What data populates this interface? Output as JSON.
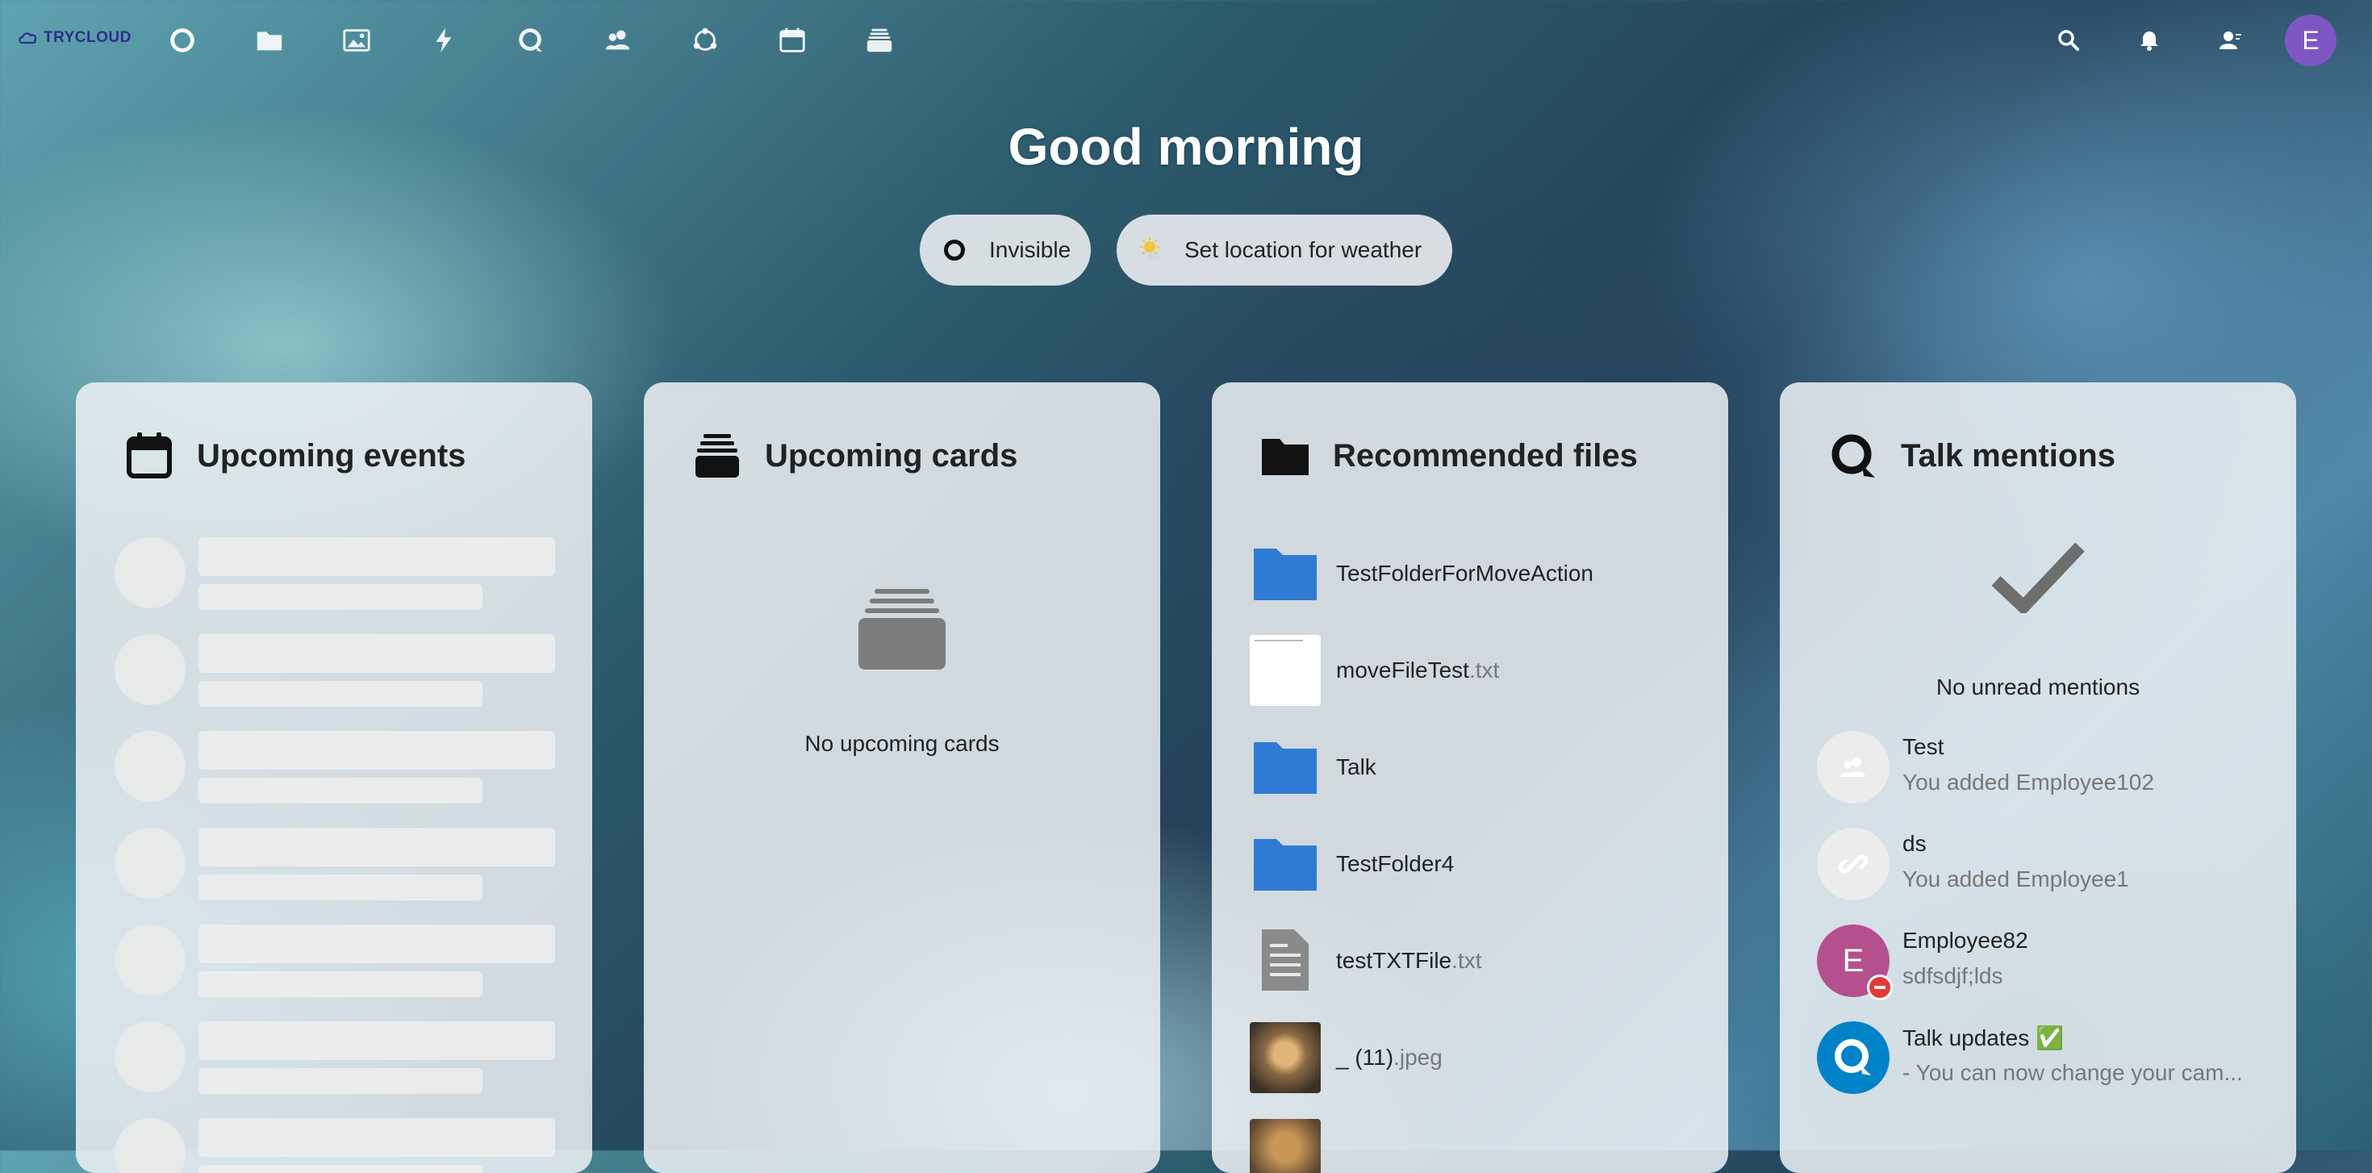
{
  "header": {
    "logo_text": "TRYCLOUD",
    "nav": [
      {
        "name": "dashboard-icon"
      },
      {
        "name": "files-icon"
      },
      {
        "name": "photos-icon"
      },
      {
        "name": "activity-icon"
      },
      {
        "name": "talk-icon"
      },
      {
        "name": "contacts-icon"
      },
      {
        "name": "circles-icon"
      },
      {
        "name": "calendar-icon"
      },
      {
        "name": "deck-icon"
      }
    ],
    "avatar_letter": "E",
    "avatar_color": "#7e57c2"
  },
  "greeting": "Good morning",
  "status": {
    "label": "Invisible"
  },
  "weather": {
    "label": "Set location for weather"
  },
  "panels": {
    "events": {
      "title": "Upcoming events"
    },
    "cards": {
      "title": "Upcoming cards",
      "empty": "No upcoming cards"
    },
    "files": {
      "title": "Recommended files",
      "items": [
        {
          "name": "TestFolderForMoveAction",
          "ext": "",
          "type": "folder"
        },
        {
          "name": "moveFileTest",
          "ext": ".txt",
          "type": "text-thumb"
        },
        {
          "name": "Talk",
          "ext": "",
          "type": "folder"
        },
        {
          "name": "TestFolder4",
          "ext": "",
          "type": "folder"
        },
        {
          "name": "testTXTFile",
          "ext": ".txt",
          "type": "document"
        },
        {
          "name": "_ (11)",
          "ext": ".jpeg",
          "type": "image"
        }
      ]
    },
    "talk": {
      "title": "Talk mentions",
      "empty": "No unread mentions",
      "conversations": [
        {
          "title": "Test",
          "subtitle": "You added Employee102",
          "avatar": "group"
        },
        {
          "title": "ds",
          "subtitle": "You added Employee1",
          "avatar": "link"
        },
        {
          "title": "Employee82",
          "subtitle": "sdfsdjf;lds",
          "avatar": "E"
        },
        {
          "title": "Talk updates ✅",
          "subtitle": "- You can now change your cam...",
          "avatar": "talk"
        }
      ]
    }
  },
  "colors": {
    "folder": "#2f7bd3",
    "accent": "#0082c9",
    "employee_avatar": "#b5508f"
  }
}
